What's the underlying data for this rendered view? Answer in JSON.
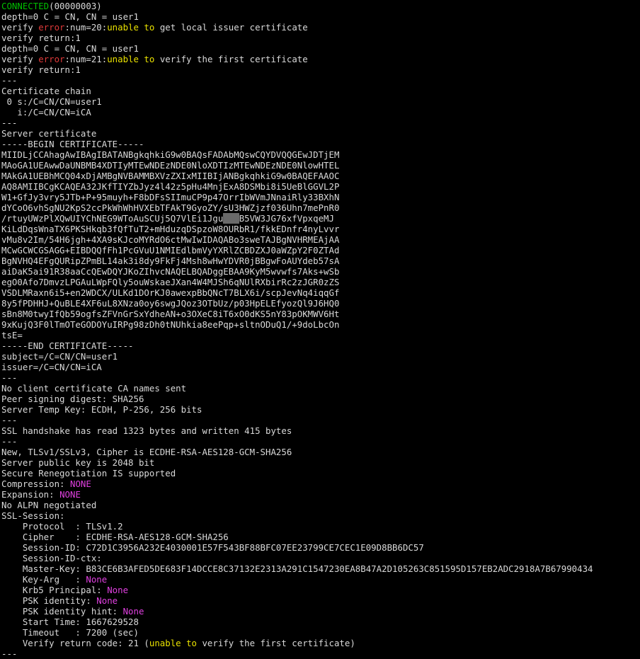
{
  "colors": {
    "background": "#000000",
    "text": "#d9d9d9",
    "green": "#00c000",
    "red": "#e03a3a",
    "yellow": "#e8e000",
    "magenta": "#e040e0"
  },
  "lines": [
    [
      {
        "t": "CONNECTED",
        "c": "green"
      },
      {
        "t": "(00000003)"
      }
    ],
    [
      {
        "t": "depth=0 C = CN, CN = user1"
      }
    ],
    [
      {
        "t": "verify "
      },
      {
        "t": "error",
        "c": "red"
      },
      {
        "t": ":num=20:"
      },
      {
        "t": "unable to",
        "c": "yellow"
      },
      {
        "t": " get local issuer certificate"
      }
    ],
    [
      {
        "t": "verify return:1"
      }
    ],
    [
      {
        "t": "depth=0 C = CN, CN = user1"
      }
    ],
    [
      {
        "t": "verify "
      },
      {
        "t": "error",
        "c": "red"
      },
      {
        "t": ":num=21:"
      },
      {
        "t": "unable to",
        "c": "yellow"
      },
      {
        "t": " verify the first certificate"
      }
    ],
    [
      {
        "t": "verify return:1"
      }
    ],
    [
      {
        "t": "---"
      }
    ],
    [
      {
        "t": "Certificate chain"
      }
    ],
    [
      {
        "t": " 0 s:/C=CN/CN=user1"
      }
    ],
    [
      {
        "t": "   i:/C=CN/CN=iCA"
      }
    ],
    [
      {
        "t": "---"
      }
    ],
    [
      {
        "t": "Server certificate"
      }
    ],
    [
      {
        "t": "-----BEGIN CERTIFICATE-----"
      }
    ],
    [
      {
        "t": "MIIDLjCCAhagAwIBAgIBATANBgkqhkiG9w0BAQsFADAbMQswCQYDVQQGEwJDTjEM"
      }
    ],
    [
      {
        "t": "MAoGA1UEAwwDaUNBMB4XDTIyMTEwNDEzNDE0NloXDTIzMTEwNDEzNDE0NlowHTEL"
      }
    ],
    [
      {
        "t": "MAkGA1UEBhMCQ04xDjAMBgNVBAMMBXVzZXIxMIIBIjANBgkqhkiG9w0BAQEFAAOC"
      }
    ],
    [
      {
        "t": "AQ8AMIIBCgKCAQEA32JKfTIYZbJyz4l42z5pHu4MnjExA8DSMbi8i5UeBlGGVL2P"
      }
    ],
    [
      {
        "t": "W1+GfJy3vry5JTb+P+95muyh+F8bDFsSIImuCP9p47OrrIbWVmJNnaiRly33BXhN"
      }
    ],
    [
      {
        "t": "dYCoO6vhSgNU2KpS2ccPkWhWhHVXEbTFAkT9GyoZY/sU3HWZjzf036Uhn7mePnR0"
      }
    ],
    [
      {
        "t": "/rtuyUWzPlXQwUIYChNEG9WToAuSCUj5Q7VlEi1Jgu"
      },
      {
        "t": "   ",
        "c": "block"
      },
      {
        "t": "B5VW3JG76xfVpxqeMJ"
      }
    ],
    [
      {
        "t": "KiLdDqsWnaTX6PKSHkqb3fQfTuT2+mHduzqDSpzoW8OURbR1/fkkEDnfr4nyLvvr"
      }
    ],
    [
      {
        "t": "vMu8v2Im/54H6jgh+4XA9sKJcoMYRdO6ctMwIwIDAQABo3sweTAJBgNVHRMEAjAA"
      }
    ],
    [
      {
        "t": "MCwGCWCGSAGG+EIBDQQfFh1PcGVuU1NMIEdlbmVyYXRlZCBDZXJ0aWZpY2F0ZTAd"
      }
    ],
    [
      {
        "t": "BgNVHQ4EFgQURipZPmBL14ak3i8dy9FkFj4Msh8wHwYDVR0jBBgwFoAUYdeb57sA"
      }
    ],
    [
      {
        "t": "aiDaK5ai91R38aaCcQEwDQYJKoZIhvcNAQELBQADggEBAA9KyM5wvwfs7Aks+wSb"
      }
    ],
    [
      {
        "t": "egO0Afo7DmvzLPGAuLWpFQly5ouWskaeJXan4W4MJSh6qNUlRXbirRc2zJGR0zZS"
      }
    ],
    [
      {
        "t": "VSDLMRaxn6i5+en2WDCX/ULKd1DOrKJ0awexpBbQNcT7BLX6i/scpJevNq4iqqGf"
      }
    ],
    [
      {
        "t": "8y5fPDHHJ+QuBLE4XF6uL8XNza0oy6swgJQoz3OTbUz/p03HpELEfyozQl9J6HQ0"
      }
    ],
    [
      {
        "t": "sBn8M0twyIfQb59ogfsZFVnGrSxYdheAN+o3OXeC8iT6xO0dKS5nY83pOKMWV6Ht"
      }
    ],
    [
      {
        "t": "9xKujQ3F0lTmOTeGODOYuIRPg98zDh0tNUhkia8eePqp+sltnODuQ1/+9doLbcOn"
      }
    ],
    [
      {
        "t": "tsE="
      }
    ],
    [
      {
        "t": "-----END CERTIFICATE-----"
      }
    ],
    [
      {
        "t": "subject=/C=CN/CN=user1"
      }
    ],
    [
      {
        "t": "issuer=/C=CN/CN=iCA"
      }
    ],
    [
      {
        "t": "---"
      }
    ],
    [
      {
        "t": "No client certificate CA names sent"
      }
    ],
    [
      {
        "t": "Peer signing digest: SHA256"
      }
    ],
    [
      {
        "t": "Server Temp Key: ECDH, P-256, 256 bits"
      }
    ],
    [
      {
        "t": "---"
      }
    ],
    [
      {
        "t": "SSL handshake has read 1323 bytes and written 415 bytes"
      }
    ],
    [
      {
        "t": "---"
      }
    ],
    [
      {
        "t": "New, TLSv1/SSLv3, Cipher is ECDHE-RSA-AES128-GCM-SHA256"
      }
    ],
    [
      {
        "t": "Server public key is 2048 bit"
      }
    ],
    [
      {
        "t": "Secure Renegotiation IS supported"
      }
    ],
    [
      {
        "t": "Compression: "
      },
      {
        "t": "NONE",
        "c": "magenta"
      }
    ],
    [
      {
        "t": "Expansion: "
      },
      {
        "t": "NONE",
        "c": "magenta"
      }
    ],
    [
      {
        "t": "No ALPN negotiated"
      }
    ],
    [
      {
        "t": "SSL-Session:"
      }
    ],
    [
      {
        "t": "    Protocol  : TLSv1.2"
      }
    ],
    [
      {
        "t": "    Cipher    : ECDHE-RSA-AES128-GCM-SHA256"
      }
    ],
    [
      {
        "t": "    Session-ID: C72D1C3956A232E4030001E57F543BF88BFC07EE23799CE7CEC1E09D8BB6DC57"
      }
    ],
    [
      {
        "t": "    Session-ID-ctx:"
      }
    ],
    [
      {
        "t": "    Master-Key: B83CE6B3AFED5DE683F14DCCE8C37132E2313A291C1547230EA8B47A2D105263C851595D157EB2ADC2918A7B67990434"
      }
    ],
    [
      {
        "t": "    Key-Arg   : "
      },
      {
        "t": "None",
        "c": "magenta"
      }
    ],
    [
      {
        "t": "    Krb5 Principal: "
      },
      {
        "t": "None",
        "c": "magenta"
      }
    ],
    [
      {
        "t": "    PSK identity: "
      },
      {
        "t": "None",
        "c": "magenta"
      }
    ],
    [
      {
        "t": "    PSK identity hint: "
      },
      {
        "t": "None",
        "c": "magenta"
      }
    ],
    [
      {
        "t": "    Start Time: 1667629528"
      }
    ],
    [
      {
        "t": "    Timeout   : 7200 (sec)"
      }
    ],
    [
      {
        "t": "    Verify return code: 21 ("
      },
      {
        "t": "unable to",
        "c": "yellow"
      },
      {
        "t": " verify the first certificate)"
      }
    ],
    [
      {
        "t": "---"
      }
    ]
  ]
}
